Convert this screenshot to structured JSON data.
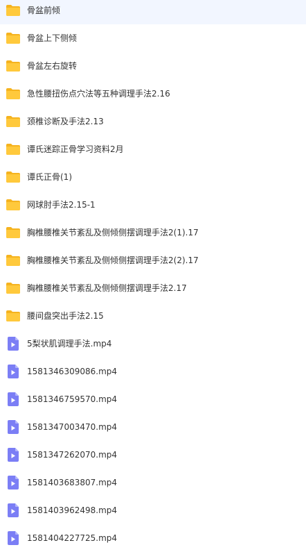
{
  "files": [
    {
      "name": "骨盆前倾",
      "type": "folder",
      "icon": "folder-icon"
    },
    {
      "name": "骨盆上下侧倾",
      "type": "folder",
      "icon": "folder-icon"
    },
    {
      "name": "骨盆左右旋转",
      "type": "folder",
      "icon": "folder-icon"
    },
    {
      "name": "急性腰扭伤点穴法等五种调理手法2.16",
      "type": "folder",
      "icon": "folder-icon"
    },
    {
      "name": "颈椎诊断及手法2.13",
      "type": "folder",
      "icon": "folder-icon"
    },
    {
      "name": "谭氏迷踪正骨学习资料2月",
      "type": "folder",
      "icon": "folder-icon"
    },
    {
      "name": "谭氏正骨(1)",
      "type": "folder",
      "icon": "folder-icon"
    },
    {
      "name": "网球肘手法2.15-1",
      "type": "folder",
      "icon": "folder-icon"
    },
    {
      "name": "胸椎腰椎关节紊乱及侧倾侧摆调理手法2(1).17",
      "type": "folder",
      "icon": "folder-icon"
    },
    {
      "name": "胸椎腰椎关节紊乱及侧倾侧摆调理手法2(2).17",
      "type": "folder",
      "icon": "folder-icon"
    },
    {
      "name": "胸椎腰椎关节紊乱及侧倾侧摆调理手法2.17",
      "type": "folder",
      "icon": "folder-icon"
    },
    {
      "name": "腰间盘突出手法2.15",
      "type": "folder",
      "icon": "folder-icon"
    },
    {
      "name": "5梨状肌调理手法.mp4",
      "type": "video",
      "icon": "video-file-icon"
    },
    {
      "name": "1581346309086.mp4",
      "type": "video",
      "icon": "video-file-icon"
    },
    {
      "name": "1581346759570.mp4",
      "type": "video",
      "icon": "video-file-icon"
    },
    {
      "name": "1581347003470.mp4",
      "type": "video",
      "icon": "video-file-icon"
    },
    {
      "name": "1581347262070.mp4",
      "type": "video",
      "icon": "video-file-icon"
    },
    {
      "name": "1581403683807.mp4",
      "type": "video",
      "icon": "video-file-icon"
    },
    {
      "name": "1581403962498.mp4",
      "type": "video",
      "icon": "video-file-icon"
    },
    {
      "name": "1581404227725.mp4",
      "type": "video",
      "icon": "video-file-icon"
    }
  ],
  "colors": {
    "folder": "#ffc93c",
    "folder_back": "#f5b31f",
    "video": "#7b7ef5",
    "video_fold": "#b3b5fb",
    "text": "#333333"
  }
}
